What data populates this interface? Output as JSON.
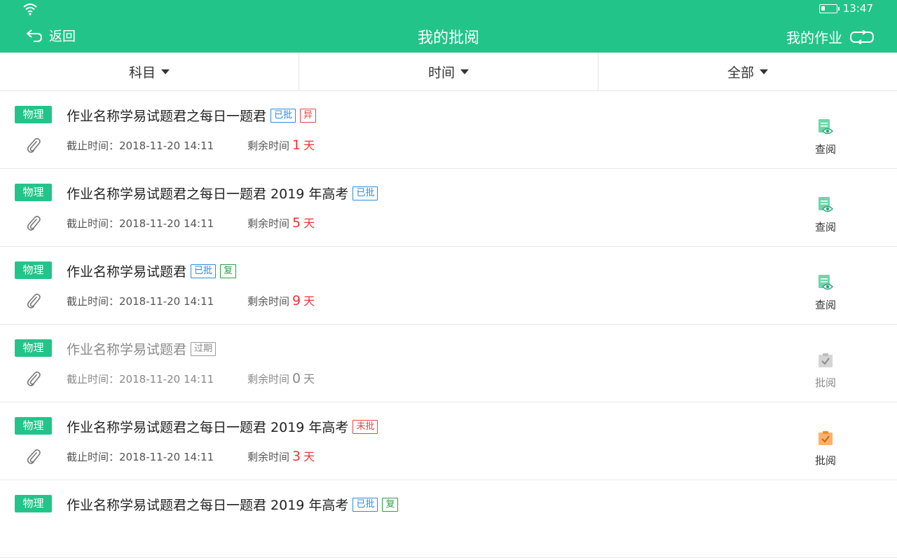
{
  "status": {
    "time": "13:47"
  },
  "header": {
    "back_label": "返回",
    "title": "我的批阅",
    "my_homework_label": "我的作业"
  },
  "filters": [
    {
      "label": "科目"
    },
    {
      "label": "时间"
    },
    {
      "label": "全部"
    }
  ],
  "list": {
    "deadline_label": "截止时间：",
    "remaining_label": "剩余时间",
    "day_unit": "天",
    "items": [
      {
        "subject": "物理",
        "name": "作业名称学易试题君之每日一题君",
        "tags": [
          {
            "text": "已批",
            "color": "blue"
          },
          {
            "text": "异",
            "color": "red"
          }
        ],
        "deadline": "2018-11-20  14:11",
        "remaining": "1",
        "action": "查阅",
        "action_icon": "doc-eye-icon",
        "muted": false
      },
      {
        "subject": "物理",
        "name": "作业名称学易试题君之每日一题君 2019 年高考",
        "tags": [
          {
            "text": "已批",
            "color": "blue"
          }
        ],
        "deadline": "2018-11-20  14:11",
        "remaining": "5",
        "action": "查阅",
        "action_icon": "doc-eye-icon",
        "muted": false
      },
      {
        "subject": "物理",
        "name": "作业名称学易试题君",
        "tags": [
          {
            "text": "已批",
            "color": "blue"
          },
          {
            "text": "复",
            "color": "green"
          }
        ],
        "deadline": "2018-11-20  14:11",
        "remaining": "9",
        "action": "查阅",
        "action_icon": "doc-eye-icon",
        "muted": false
      },
      {
        "subject": "物理",
        "name": "作业名称学易试题君",
        "tags": [
          {
            "text": "过期",
            "color": "gray"
          }
        ],
        "deadline": "2018-11-20  14:11",
        "remaining": "0",
        "action": "批阅",
        "action_icon": "clipboard-check-gray-icon",
        "muted": true
      },
      {
        "subject": "物理",
        "name": "作业名称学易试题君之每日一题君 2019 年高考",
        "tags": [
          {
            "text": "未批",
            "color": "red"
          }
        ],
        "deadline": "2018-11-20  14:11",
        "remaining": "3",
        "action": "批阅",
        "action_icon": "clipboard-check-orange-icon",
        "muted": false
      },
      {
        "subject": "物理",
        "name": "作业名称学易试题君之每日一题君 2019 年高考",
        "tags": [
          {
            "text": "已批",
            "color": "blue"
          },
          {
            "text": "复",
            "color": "green"
          }
        ],
        "deadline": "",
        "remaining": "",
        "action": "",
        "action_icon": "",
        "muted": false
      }
    ]
  },
  "colors": {
    "accent": "#23c48a",
    "remaining": "#e33333",
    "tag_blue": "#2a8de0",
    "tag_red": "#e64545",
    "tag_green": "#2e9e46"
  }
}
